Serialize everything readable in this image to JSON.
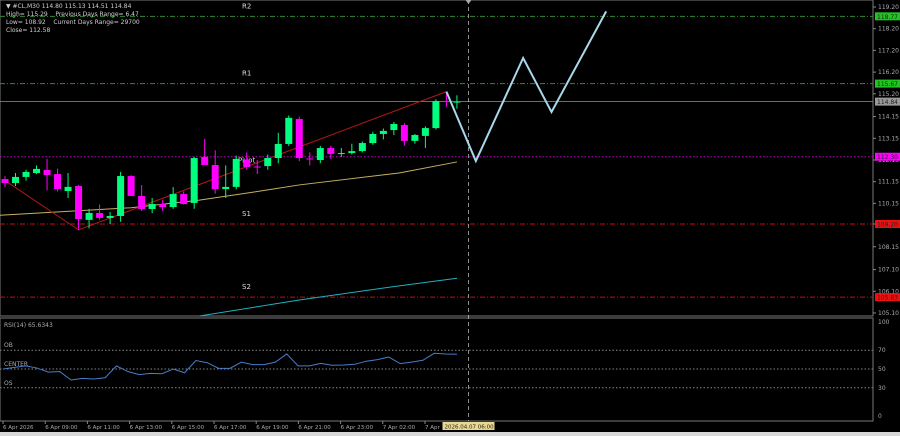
{
  "header": {
    "symbol_line": "▼ #CL,M30 114.80 115.13 114.51 114.84",
    "line2": "High= 115.29    Previous Days Range= 6.47",
    "line3": "Low= 108.92    Current Days Range= 29700",
    "line4": "Close= 112.58"
  },
  "colors": {
    "bull": "#00ff7f",
    "bear": "#ff00ff",
    "resistance": "#2e8b2e",
    "pivot": "#c000c0",
    "support": "#c01010",
    "projection": "#a8d8ea",
    "zigzag": "#b01818",
    "ma_slow": "#c8b060",
    "ma_long": "#20b0c0",
    "rsi": "#4a7cc8",
    "current": "#909090"
  },
  "levels": [
    {
      "name": "R2",
      "price": 118.77,
      "label": "118.77",
      "type": "resistance"
    },
    {
      "name": "R1",
      "price": 115.67,
      "label": "115.67",
      "type": "resistance"
    },
    {
      "name": "Pivot",
      "price": 112.3,
      "label": "112.30",
      "type": "pivot"
    },
    {
      "name": "S1",
      "price": 109.2,
      "label": "109.20",
      "type": "support"
    },
    {
      "name": "S2",
      "price": 105.83,
      "label": "105.83",
      "type": "support"
    }
  ],
  "current_price": {
    "price": 114.84,
    "label": "114.84"
  },
  "price_axis": [
    "119.20",
    "118.20",
    "117.20",
    "116.20",
    "115.20",
    "114.15",
    "113.15",
    "112.15",
    "111.15",
    "110.15",
    "109.20",
    "108.15",
    "107.10",
    "106.10",
    "105.10"
  ],
  "candles": [
    [
      111.27,
      111.4,
      110.9,
      111.09
    ],
    [
      111.09,
      111.55,
      110.95,
      111.37
    ],
    [
      111.37,
      111.7,
      111.2,
      111.6
    ],
    [
      111.55,
      111.9,
      111.5,
      111.74
    ],
    [
      111.69,
      112.2,
      110.75,
      111.46
    ],
    [
      111.5,
      111.75,
      110.7,
      110.81
    ],
    [
      110.72,
      111.55,
      110.4,
      110.91
    ],
    [
      110.95,
      111.0,
      108.93,
      109.43
    ],
    [
      109.39,
      109.9,
      109.0,
      109.71
    ],
    [
      109.71,
      110.1,
      109.4,
      109.48
    ],
    [
      109.48,
      109.75,
      109.2,
      109.57
    ],
    [
      109.57,
      111.6,
      109.3,
      111.41
    ],
    [
      111.41,
      111.45,
      110.49,
      110.49
    ],
    [
      110.49,
      111.0,
      109.8,
      109.89
    ],
    [
      109.89,
      110.4,
      109.7,
      110.12
    ],
    [
      110.12,
      110.3,
      109.8,
      109.98
    ],
    [
      109.98,
      110.9,
      109.9,
      110.58
    ],
    [
      110.58,
      110.7,
      110.1,
      110.12
    ],
    [
      110.17,
      112.3,
      109.9,
      112.24
    ],
    [
      112.29,
      113.12,
      112.1,
      111.92
    ],
    [
      111.92,
      112.6,
      110.6,
      110.81
    ],
    [
      110.81,
      111.9,
      110.4,
      110.91
    ],
    [
      110.91,
      112.35,
      110.8,
      112.2
    ],
    [
      112.15,
      112.5,
      111.7,
      111.83
    ],
    [
      111.85,
      112.15,
      111.5,
      111.83
    ],
    [
      111.87,
      112.4,
      111.7,
      112.24
    ],
    [
      112.24,
      113.4,
      112.0,
      112.89
    ],
    [
      112.89,
      114.2,
      112.8,
      114.09
    ],
    [
      114.04,
      114.15,
      112.1,
      112.24
    ],
    [
      112.22,
      112.5,
      111.9,
      112.2
    ],
    [
      112.15,
      112.8,
      112.0,
      112.7
    ],
    [
      112.7,
      112.8,
      112.2,
      112.43
    ],
    [
      112.45,
      112.7,
      112.3,
      112.47
    ],
    [
      112.47,
      112.9,
      112.4,
      112.56
    ],
    [
      112.56,
      113.0,
      112.5,
      112.93
    ],
    [
      112.93,
      113.45,
      112.85,
      113.35
    ],
    [
      113.35,
      113.6,
      113.1,
      113.49
    ],
    [
      113.53,
      113.9,
      113.3,
      113.81
    ],
    [
      113.76,
      113.85,
      112.8,
      113.03
    ],
    [
      113.03,
      113.35,
      112.9,
      113.3
    ],
    [
      113.26,
      113.7,
      112.7,
      113.62
    ],
    [
      113.62,
      114.95,
      113.55,
      114.87
    ],
    [
      114.87,
      115.29,
      114.6,
      114.82
    ],
    [
      114.8,
      115.13,
      114.51,
      114.84
    ]
  ],
  "zigzag": [
    [
      0,
      111.2
    ],
    [
      7,
      108.93
    ],
    [
      42,
      115.3
    ]
  ],
  "projection": [
    [
      42,
      115.3
    ],
    [
      44.8,
      112.1
    ],
    [
      49.3,
      116.85
    ],
    [
      52,
      114.36
    ],
    [
      57.2,
      119.0
    ]
  ],
  "ma_slow": [
    [
      -0.5,
      109.6
    ],
    [
      12,
      109.95
    ],
    [
      18.5,
      110.3
    ],
    [
      25,
      110.77
    ],
    [
      28,
      111.0
    ],
    [
      37.5,
      111.55
    ],
    [
      43,
      112.06
    ]
  ],
  "ma_long": [
    [
      18.5,
      104.96
    ],
    [
      28,
      105.7
    ],
    [
      37.5,
      106.35
    ],
    [
      43,
      106.7
    ]
  ],
  "crosshair": {
    "bar": 44.1,
    "time_label": "2026.04.07 06:00"
  },
  "rsi": {
    "label": "RSI(14) 65.6343",
    "levels": [
      {
        "name": "OB",
        "value": 70
      },
      {
        "name": "CENTER",
        "value": 50
      },
      {
        "name": "OS",
        "value": 30
      }
    ],
    "axis": [
      "100",
      "70",
      "50",
      "30",
      "0"
    ],
    "values": [
      50,
      51.7,
      53.3,
      51,
      46.7,
      47.3,
      38.3,
      40,
      39.3,
      40.7,
      53.3,
      47.3,
      44,
      45.3,
      45,
      50,
      46,
      59,
      56.7,
      50.7,
      50.7,
      57.3,
      54.7,
      54.7,
      57.3,
      66,
      53.3,
      53.3,
      56,
      54,
      54.3,
      55,
      58.3,
      60,
      62.7,
      55.7,
      57.3,
      59.3,
      66.7,
      66,
      65.63
    ]
  },
  "time_axis": [
    "6 Apr 2026",
    "6 Apr 09:00",
    "6 Apr 11:00",
    "6 Apr 13:00",
    "6 Apr 15:00",
    "6 Apr 17:00",
    "6 Apr 19:00",
    "6 Apr 21:00",
    "6 Apr 23:00",
    "7 Apr 02:00",
    "7 Apr"
  ]
}
